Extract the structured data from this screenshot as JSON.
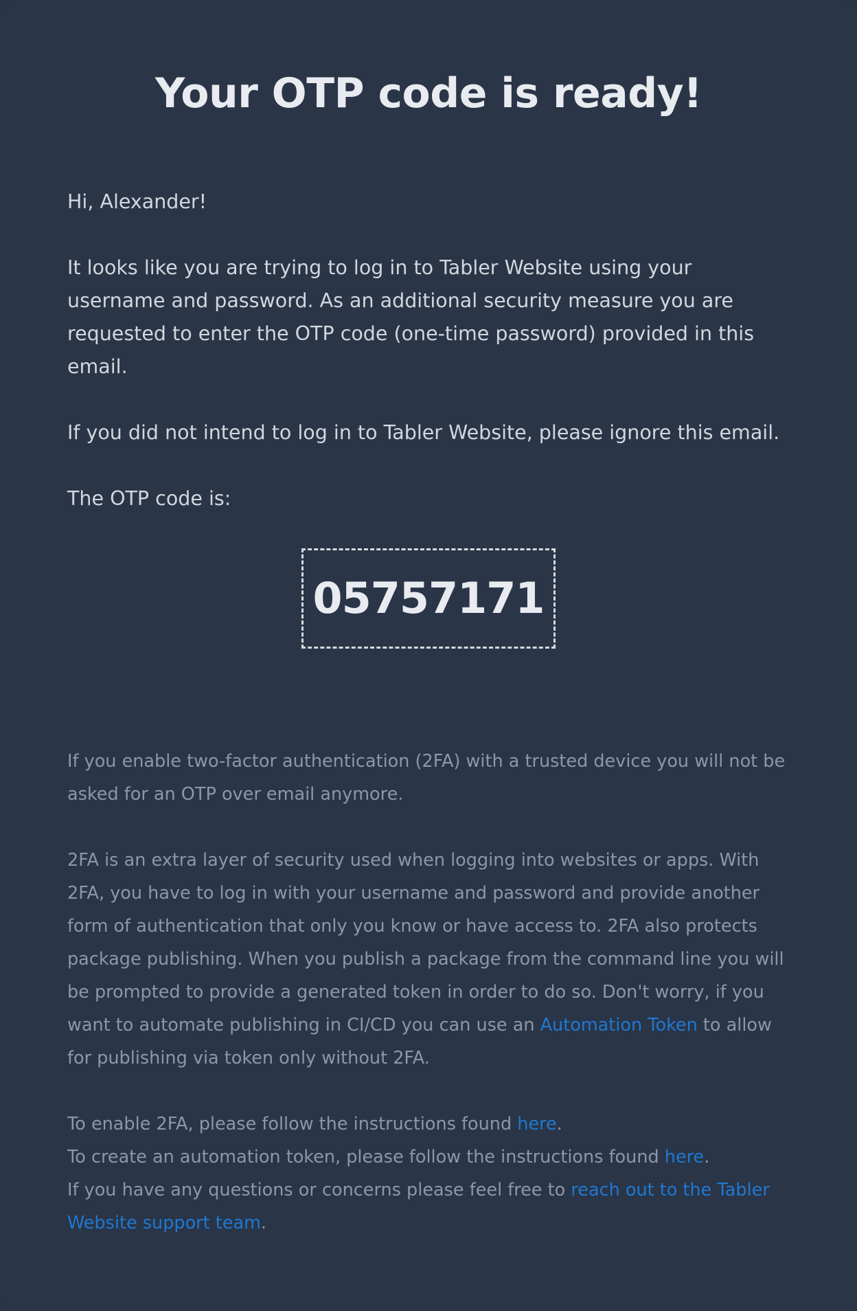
{
  "email": {
    "title": "Your OTP code is ready!",
    "greeting": "Hi, Alexander!",
    "intro": "It looks like you are trying to log in to Tabler Website using your username and password. As an additional security measure you are requested to enter the OTP code (one-time password) provided in this email.",
    "ignore_notice": "If you did not intend to log in to Tabler Website, please ignore this email.",
    "code_label": "The OTP code is:",
    "otp_code": "05757171",
    "twofa_notice": "If you enable two-factor authentication (2FA) with a trusted device you will not be asked for an OTP over email anymore.",
    "twofa_explainer_before": "2FA is an extra layer of security used when logging into websites or apps. With 2FA, you have to log in with your username and password and provide another form of authentication that only you know or have access to. 2FA also protects package publishing. When you publish a package from the command line you will be prompted to provide a generated token in order to do so. Don't worry, if you want to automate publishing in CI/CD you can use an ",
    "automation_token_link": "Automation Token",
    "twofa_explainer_after": " to allow for publishing via token only without 2FA.",
    "enable_2fa_text": "To enable 2FA, please follow the instructions found ",
    "enable_2fa_link": "here",
    "create_token_text": "To create an automation token, please follow the instructions found ",
    "create_token_link": "here",
    "questions_text": "If you have any questions or concerns please feel free to ",
    "support_link": "reach out to the Tabler Website support team",
    "period": "."
  },
  "colors": {
    "background": "#2a3547",
    "link": "#1f78d1",
    "muted_text": "#8d97a7",
    "primary_text": "#d2d7df"
  }
}
